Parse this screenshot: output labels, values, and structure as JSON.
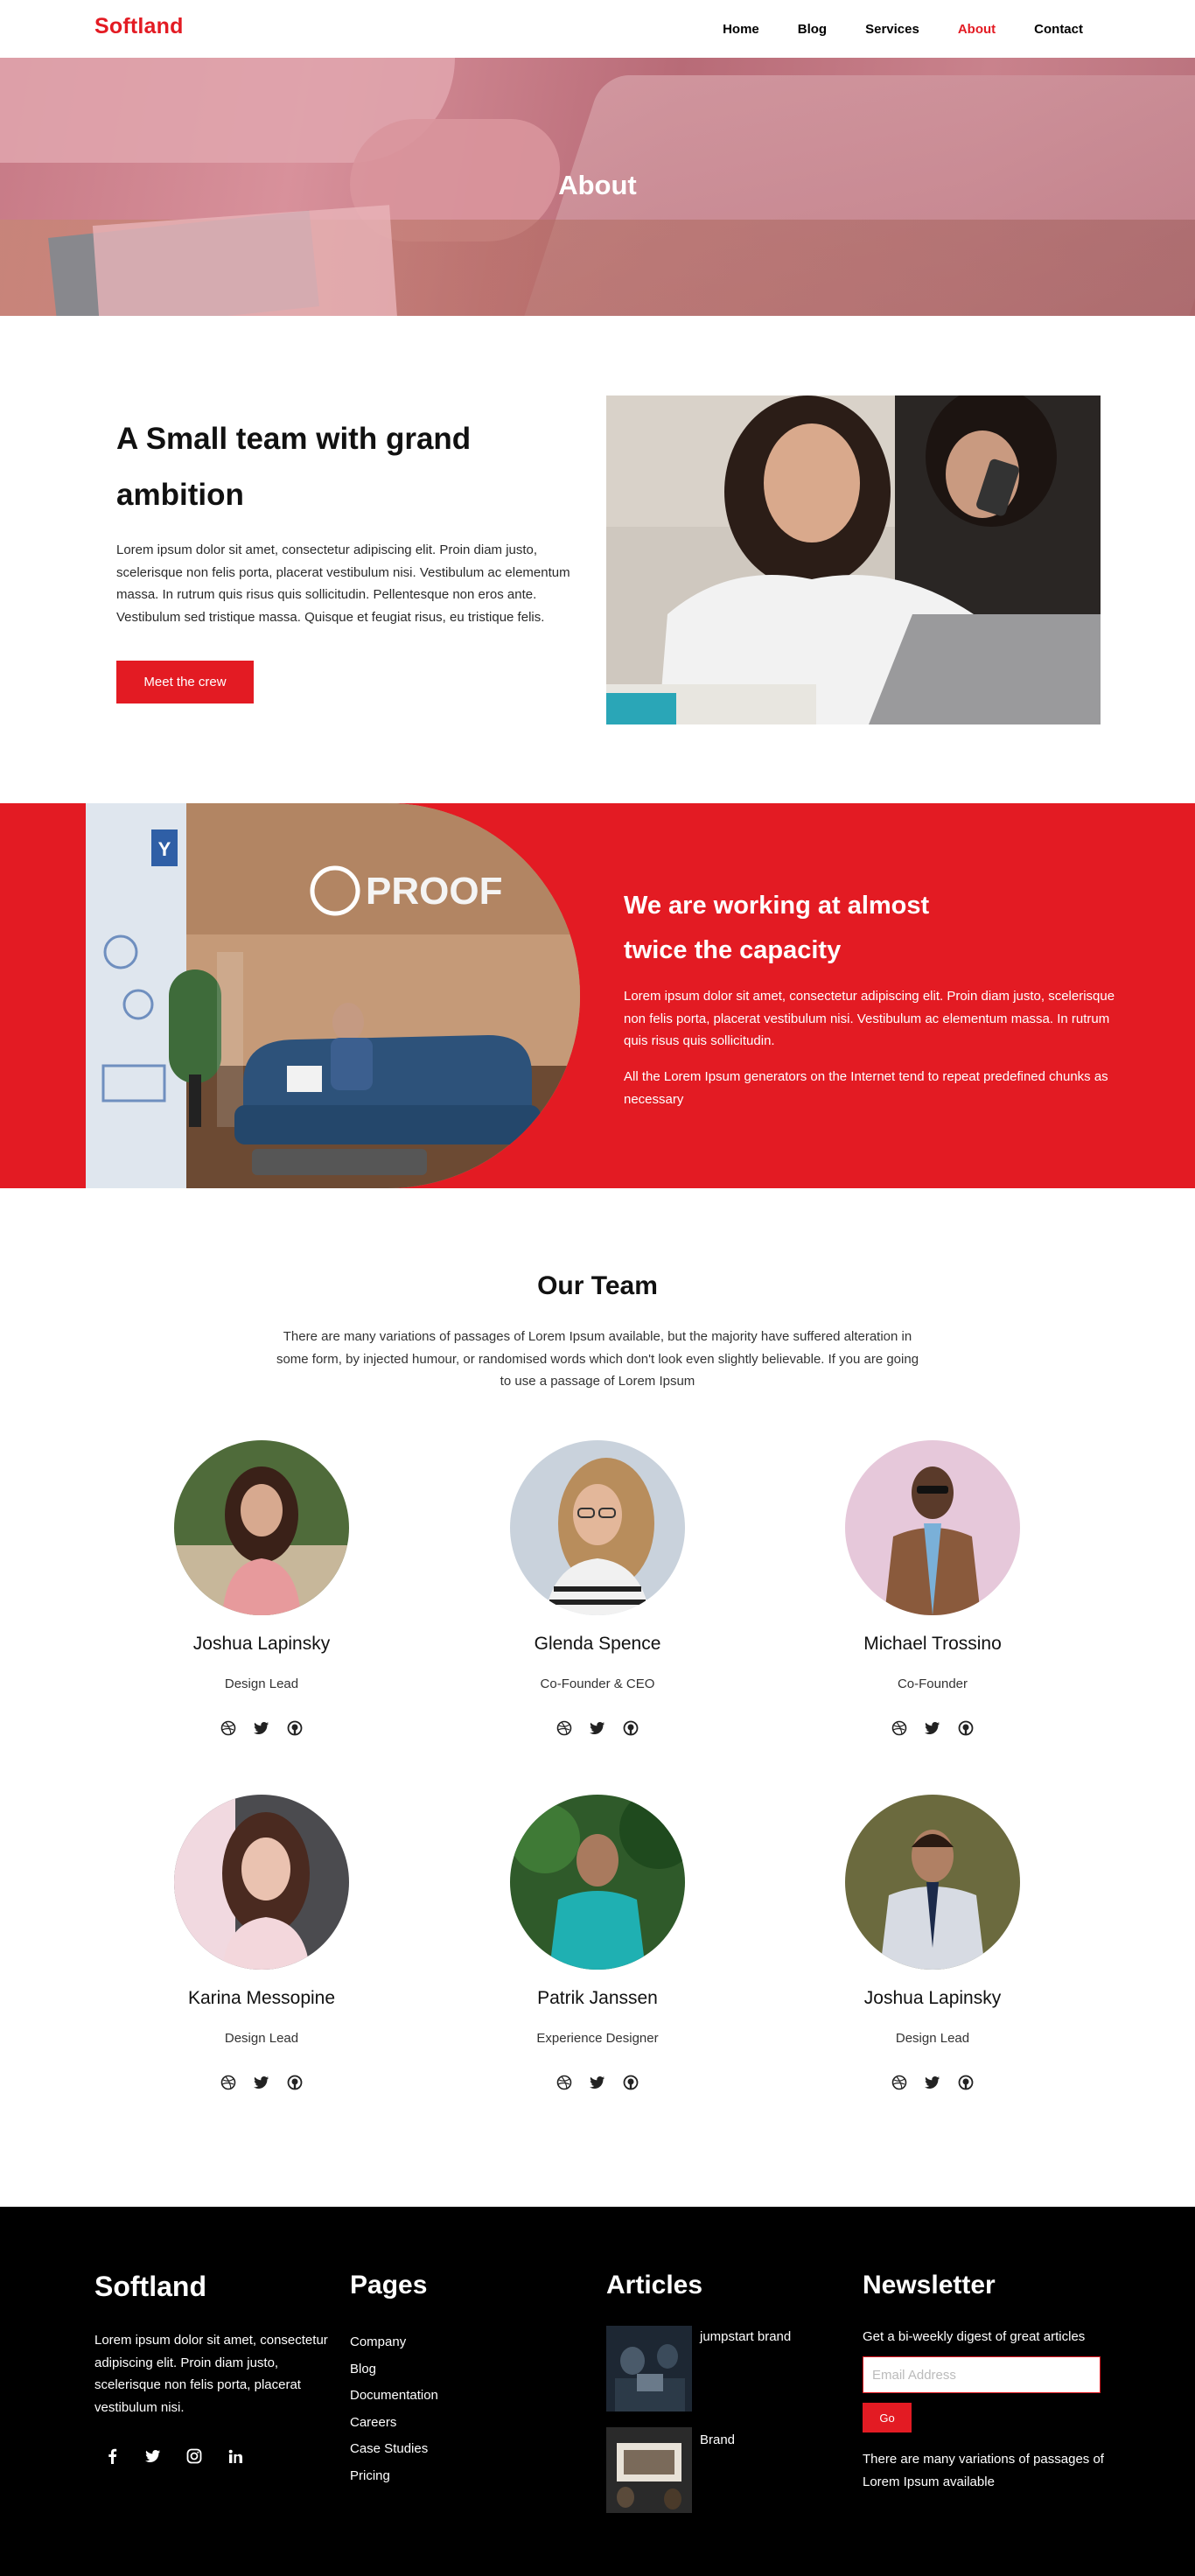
{
  "header": {
    "brand": "Softland",
    "nav": [
      "Home",
      "Blog",
      "Services",
      "About",
      "Contact"
    ],
    "active_nav": "About"
  },
  "hero": {
    "title": "About"
  },
  "intro": {
    "title": "A Small team with grand ambition",
    "text": "Lorem ipsum dolor sit amet, consectetur adipiscing elit. Proin diam justo, scelerisque non felis porta, placerat vestibulum nisi. Vestibulum ac elementum massa. In rutrum quis risus quis sollicitudin. Pellentesque non eros ante. Vestibulum sed tristique massa. Quisque et feugiat risus, eu tristique felis.",
    "button": "Meet the crew"
  },
  "working": {
    "title": "We are working at almost twice the capacity",
    "text1": "Lorem ipsum dolor sit amet, consectetur adipiscing elit. Proin diam justo, scelerisque non felis porta, placerat vestibulum nisi. Vestibulum ac elementum massa. In rutrum quis risus quis sollicitudin.",
    "text2": "All the Lorem Ipsum generators on the Internet tend to repeat predefined chunks as necessary",
    "sign": "PROOF",
    "board_letter": "Y"
  },
  "team": {
    "title": "Our Team",
    "description": "There are many variations of passages of Lorem Ipsum available, but the majority have suffered alteration in some form, by injected humour, or randomised words which don't look even slightly believable. If you are going to use a passage of Lorem Ipsum",
    "members": [
      {
        "name": "Joshua Lapinsky",
        "role": "Design Lead"
      },
      {
        "name": "Glenda Spence",
        "role": "Co-Founder & CEO"
      },
      {
        "name": "Michael Trossino",
        "role": "Co-Founder"
      },
      {
        "name": "Karina Messopine",
        "role": "Design Lead"
      },
      {
        "name": "Patrik Janssen",
        "role": "Experience Designer"
      },
      {
        "name": "Joshua Lapinsky",
        "role": "Design Lead"
      }
    ],
    "social_icons": [
      "dribbble-icon",
      "twitter-icon",
      "github-icon"
    ]
  },
  "footer": {
    "brand": "Softland",
    "text": "Lorem ipsum dolor sit amet, consectetur adipiscing elit. Proin diam justo, scelerisque non felis porta, placerat vestibulum nisi.",
    "social_icons": [
      "facebook-icon",
      "twitter-icon",
      "instagram-icon",
      "linkedin-icon"
    ],
    "pages_title": "Pages",
    "pages": [
      "Company",
      "Blog",
      "Documentation",
      "Careers",
      "Case Studies",
      "Pricing"
    ],
    "articles_title": "Articles",
    "articles": [
      "jumpstart brand",
      "Brand"
    ],
    "newsletter_title": "Newsletter",
    "newsletter_text": "Get a bi-weekly digest of great articles",
    "email_placeholder": "Email Address",
    "go_button": "Go",
    "newsletter_note": "There are many variations of passages of Lorem Ipsum available"
  },
  "colors": {
    "accent": "#e31b23",
    "footer_bg": "#000000"
  }
}
